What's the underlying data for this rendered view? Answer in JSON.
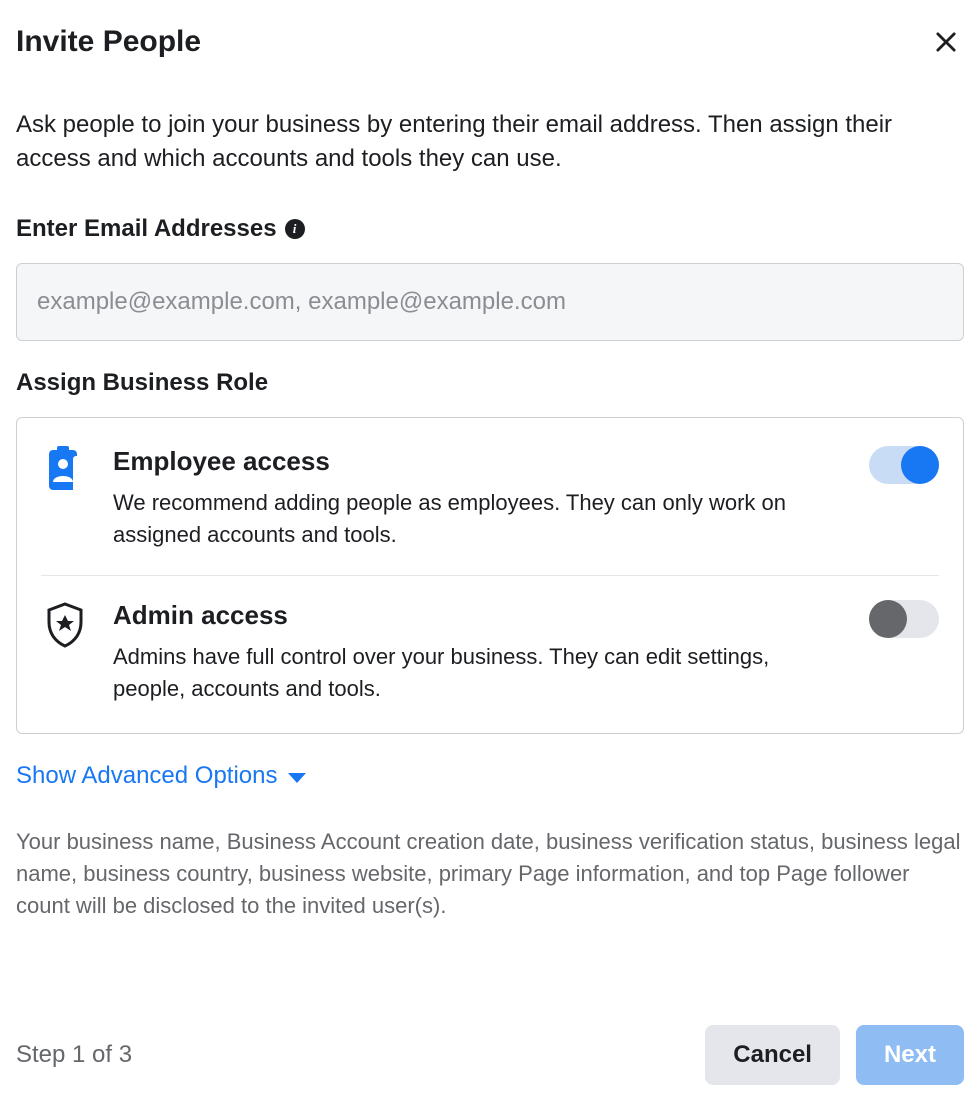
{
  "modal": {
    "title": "Invite People",
    "description": "Ask people to join your business by entering their email address. Then assign their access and which accounts and tools they can use."
  },
  "email": {
    "label": "Enter Email Addresses",
    "placeholder": "example@example.com, example@example.com",
    "value": ""
  },
  "role": {
    "label": "Assign Business Role",
    "options": [
      {
        "title": "Employee access",
        "description": "We recommend adding people as employees. They can only work on assigned accounts and tools.",
        "enabled": true
      },
      {
        "title": "Admin access",
        "description": "Admins have full control over your business. They can edit settings, people, accounts and tools.",
        "enabled": false
      }
    ]
  },
  "advanced": {
    "label": "Show Advanced Options"
  },
  "disclosure": "Your business name, Business Account creation date, business verification status, business legal name, business country, business website, primary Page information, and top Page follower count will be disclosed to the invited user(s).",
  "footer": {
    "step": "Step 1 of 3",
    "cancel": "Cancel",
    "next": "Next"
  }
}
